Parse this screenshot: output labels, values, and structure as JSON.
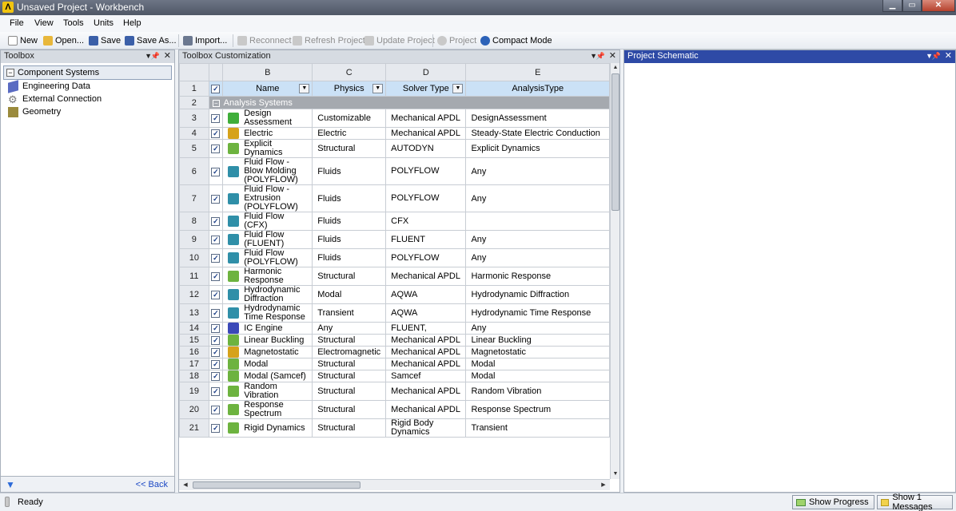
{
  "window": {
    "title": "Unsaved Project - Workbench"
  },
  "menu": [
    "File",
    "View",
    "Tools",
    "Units",
    "Help"
  ],
  "toolbar": {
    "new": "New",
    "open": "Open...",
    "save": "Save",
    "save_as": "Save As...",
    "import": "Import...",
    "reconnect": "Reconnect",
    "refresh": "Refresh Project",
    "update": "Update Project",
    "project": "Project",
    "compact": "Compact Mode"
  },
  "toolbox": {
    "title": "Toolbox",
    "group": "Component Systems",
    "items": [
      "Engineering Data",
      "External Connection",
      "Geometry"
    ],
    "back": "<< Back"
  },
  "customization": {
    "title": "Toolbox Customization",
    "col_letters": [
      "B",
      "C",
      "D",
      "E"
    ],
    "headers": [
      "Name",
      "Physics",
      "Solver Type",
      "AnalysisType"
    ],
    "group_label": "Analysis Systems",
    "rows": [
      {
        "n": "3",
        "name": "Design Assessment",
        "physics": "Customizable",
        "solver": "Mechanical APDL",
        "analysis": "DesignAssessment",
        "color": "#3fae3a"
      },
      {
        "n": "4",
        "name": "Electric",
        "physics": "Electric",
        "solver": "Mechanical APDL",
        "analysis": "Steady-State Electric Conduction",
        "color": "#d6a21a"
      },
      {
        "n": "5",
        "name": "Explicit Dynamics",
        "physics": "Structural",
        "solver": "AUTODYN",
        "analysis": "Explicit Dynamics",
        "color": "#6db33f"
      },
      {
        "n": "6",
        "name": "Fluid Flow - Blow Molding (POLYFLOW)",
        "physics": "Fluids",
        "solver": "POLYFLOW",
        "analysis": "Any",
        "color": "#2f8fa8"
      },
      {
        "n": "7",
        "name": "Fluid Flow - Extrusion (POLYFLOW)",
        "physics": "Fluids",
        "solver": "POLYFLOW",
        "analysis": "Any",
        "color": "#2f8fa8"
      },
      {
        "n": "8",
        "name": "Fluid Flow (CFX)",
        "physics": "Fluids",
        "solver": "CFX",
        "analysis": "",
        "color": "#2f8fa8"
      },
      {
        "n": "9",
        "name": "Fluid Flow (FLUENT)",
        "physics": "Fluids",
        "solver": "FLUENT",
        "analysis": "Any",
        "color": "#2f8fa8"
      },
      {
        "n": "10",
        "name": "Fluid Flow (POLYFLOW)",
        "physics": "Fluids",
        "solver": "POLYFLOW",
        "analysis": "Any",
        "color": "#2f8fa8"
      },
      {
        "n": "11",
        "name": "Harmonic Response",
        "physics": "Structural",
        "solver": "Mechanical APDL",
        "analysis": "Harmonic Response",
        "color": "#6db33f"
      },
      {
        "n": "12",
        "name": "Hydrodynamic Diffraction",
        "physics": "Modal",
        "solver": "AQWA",
        "analysis": "Hydrodynamic Diffraction",
        "color": "#2f8fa8"
      },
      {
        "n": "13",
        "name": "Hydrodynamic Time Response",
        "physics": "Transient",
        "solver": "AQWA",
        "analysis": "Hydrodynamic Time Response",
        "color": "#2f8fa8"
      },
      {
        "n": "14",
        "name": "IC Engine",
        "physics": "Any",
        "solver": "FLUENT,",
        "analysis": "Any",
        "color": "#3b49b8"
      },
      {
        "n": "15",
        "name": "Linear Buckling",
        "physics": "Structural",
        "solver": "Mechanical APDL",
        "analysis": "Linear Buckling",
        "color": "#6db33f"
      },
      {
        "n": "16",
        "name": "Magnetostatic",
        "physics": "Electromagnetic",
        "solver": "Mechanical APDL",
        "analysis": "Magnetostatic",
        "color": "#d6a21a"
      },
      {
        "n": "17",
        "name": "Modal",
        "physics": "Structural",
        "solver": "Mechanical APDL",
        "analysis": "Modal",
        "color": "#6db33f"
      },
      {
        "n": "18",
        "name": "Modal (Samcef)",
        "physics": "Structural",
        "solver": "Samcef",
        "analysis": "Modal",
        "color": "#6db33f"
      },
      {
        "n": "19",
        "name": "Random Vibration",
        "physics": "Structural",
        "solver": "Mechanical APDL",
        "analysis": "Random Vibration",
        "color": "#6db33f"
      },
      {
        "n": "20",
        "name": "Response Spectrum",
        "physics": "Structural",
        "solver": "Mechanical APDL",
        "analysis": "Response Spectrum",
        "color": "#6db33f"
      },
      {
        "n": "21",
        "name": "Rigid Dynamics",
        "physics": "Structural",
        "solver": "Rigid Body Dynamics",
        "analysis": "Transient",
        "color": "#6db33f"
      }
    ]
  },
  "schematic": {
    "title": "Project Schematic"
  },
  "status": {
    "ready": "Ready",
    "progress": "Show Progress",
    "messages": "Show 1 Messages"
  }
}
